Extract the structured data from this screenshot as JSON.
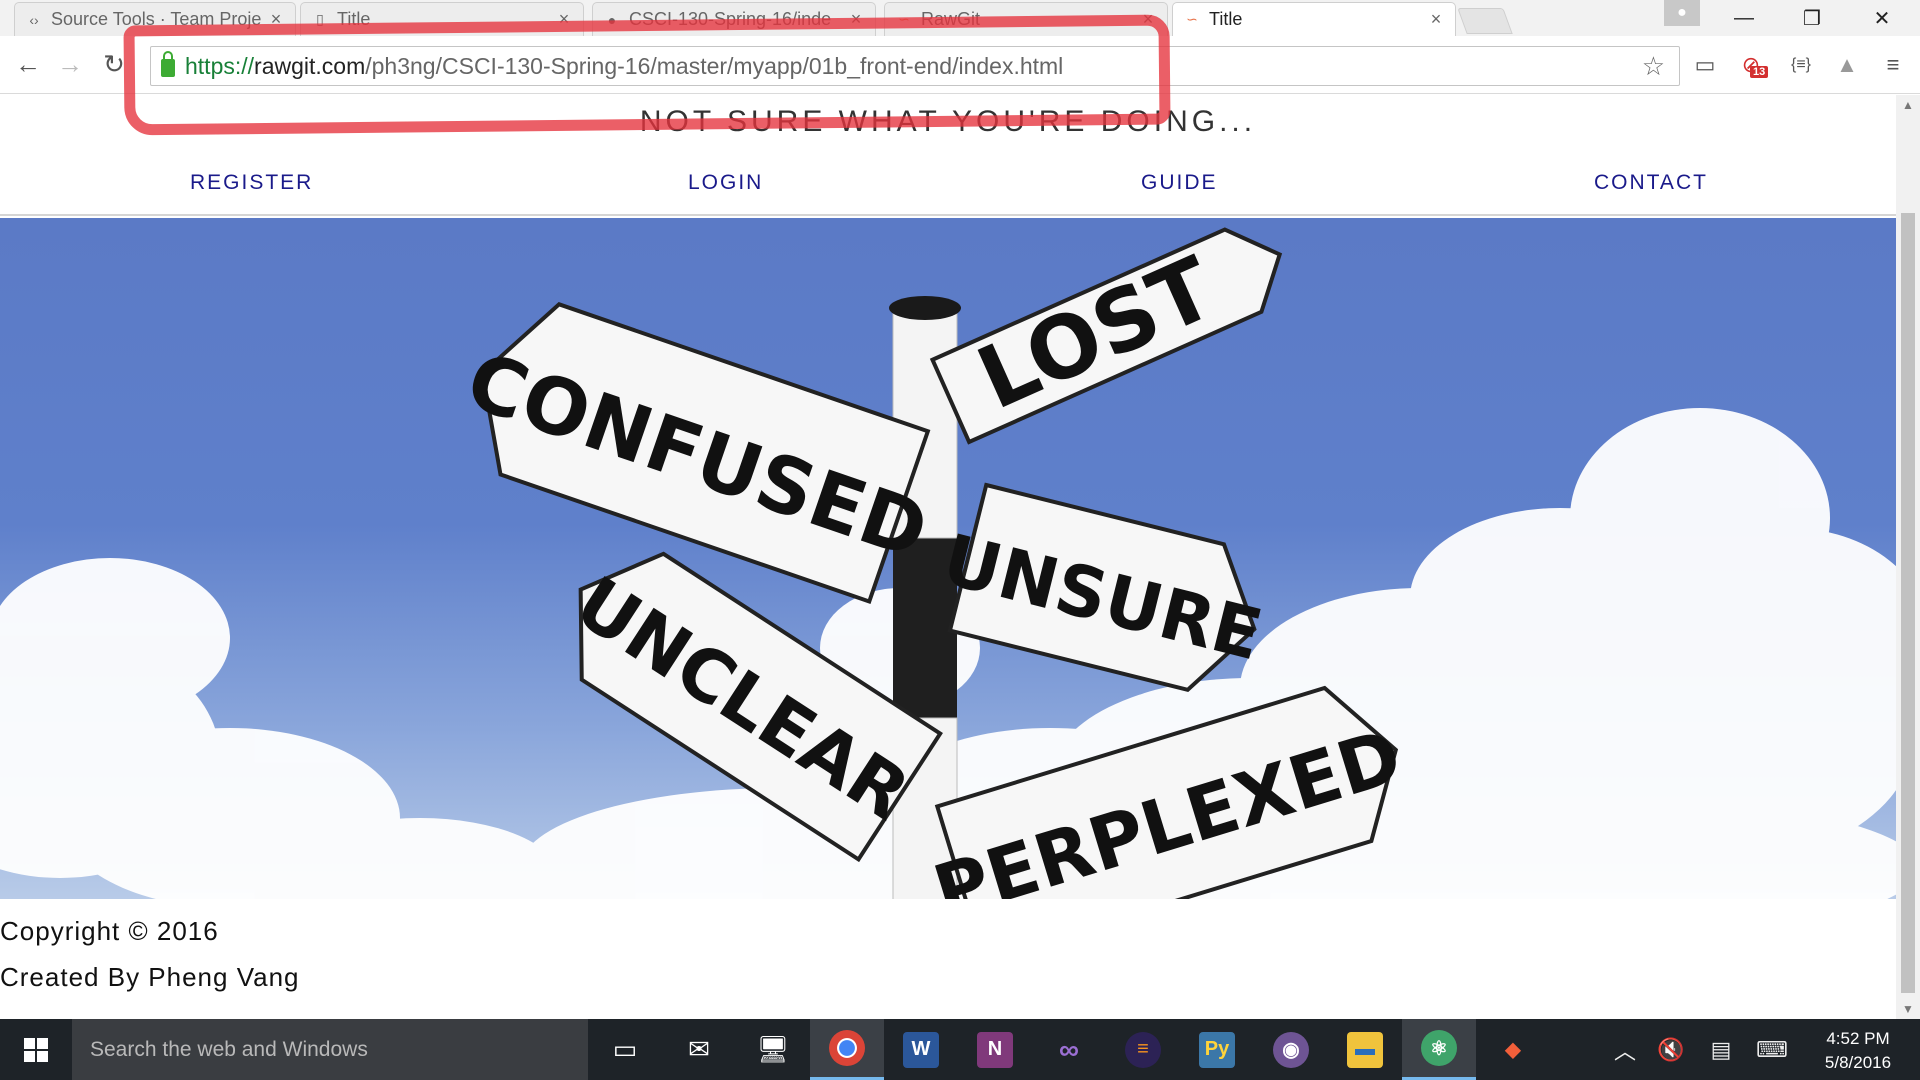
{
  "browser": {
    "tabs": [
      {
        "label": "Source Tools · Team Proje",
        "icon": "source-tools-icon",
        "active": false
      },
      {
        "label": "Title",
        "icon": "document-icon",
        "active": false
      },
      {
        "label": "CSCI-130-Spring-16/inde",
        "icon": "github-icon",
        "active": false
      },
      {
        "label": "RawGit",
        "icon": "rawgit-icon",
        "active": false
      },
      {
        "label": "Title",
        "icon": "rawgit-icon",
        "active": true
      }
    ],
    "url": {
      "scheme": "https://",
      "host": "rawgit.com",
      "path": "/ph3ng/CSCI-130-Spring-16/master/myapp/01b_front-end/index.html"
    },
    "extension_badge": "13"
  },
  "page": {
    "tagline": "NOT SURE WHAT YOU'RE DOING...",
    "nav": [
      "REGISTER",
      "LOGIN",
      "GUIDE",
      "CONTACT"
    ],
    "hero": {
      "signs": [
        "LOST",
        "CONFUSED",
        "UNSURE",
        "UNCLEAR",
        "PERPLEXED"
      ]
    },
    "footer": {
      "copyright": "Copyright © 2016",
      "credit": "Created By Pheng Vang"
    }
  },
  "taskbar": {
    "search_placeholder": "Search the web and Windows",
    "apps": [
      "task-view",
      "mail",
      "network",
      "chrome",
      "word",
      "onenote",
      "visual-studio",
      "eclipse",
      "python-idle",
      "github-desktop",
      "file-explorer",
      "atom",
      "gitkraken"
    ],
    "time": "4:52 PM",
    "date": "5/8/2016"
  },
  "colors": {
    "annotation": "#e6323c",
    "nav_link": "#1a1a8a",
    "sky": "#5b7ac6",
    "taskbar": "#1e2328"
  }
}
